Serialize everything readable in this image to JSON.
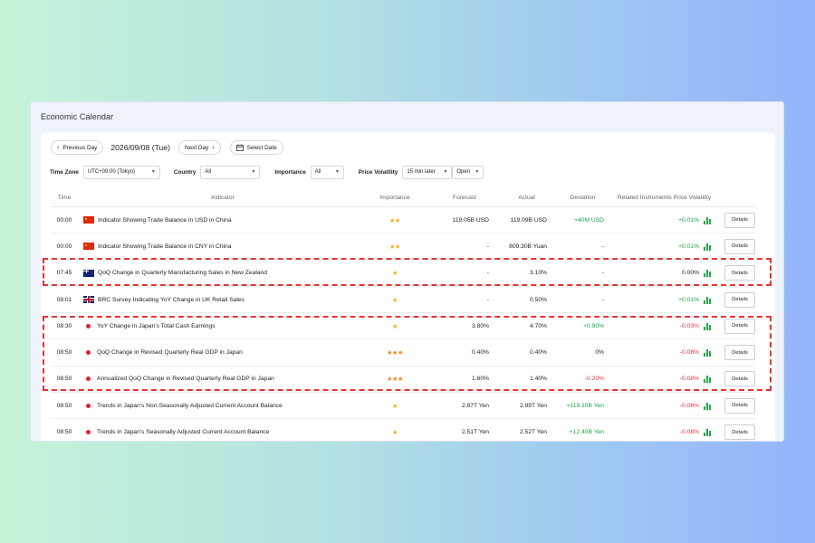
{
  "panel": {
    "title": "Economic Calendar"
  },
  "toolbar": {
    "prev_label": "Previous Day",
    "date": "2026/09/08 (Tue)",
    "next_label": "Next Day",
    "select_date_label": "Select Date"
  },
  "filters": {
    "timezone_label": "Time Zone",
    "timezone_value": "UTC+09:00 (Tokyo)",
    "country_label": "Country",
    "country_value": "All",
    "importance_label": "Importance",
    "importance_value": "All",
    "volatility_label": "Price Volatility",
    "volatility_value": "15 min later",
    "volatility_mode": "Open"
  },
  "table": {
    "headers": {
      "time": "Time",
      "indicator": "Indicator",
      "importance": "Importance",
      "forecast": "Forecast",
      "actual": "Actual",
      "deviation": "Deviation",
      "volatility": "Related Instruments Price Volatility"
    },
    "details_label": "Details",
    "rows": [
      {
        "time": "00:00",
        "flag": "cn",
        "indicator": "Indicator Showing Trade Balance in USD in China",
        "importance": "★★",
        "forecast": "119.05B USD",
        "actual": "119.09B USD",
        "deviation": "+40M USD",
        "volatility": "+0.01%"
      },
      {
        "time": "00:00",
        "flag": "cn",
        "indicator": "Indicator Showing Trade Balance in CNY in China",
        "importance": "★★",
        "forecast": "-",
        "actual": "809.30B Yuan",
        "deviation": "-",
        "volatility": "+0.01%"
      },
      {
        "time": "07:45",
        "flag": "nz",
        "indicator": "QoQ Change in Quarterly Manufacturing Sales in New Zealand",
        "importance": "★",
        "forecast": "-",
        "actual": "3.10%",
        "deviation": "-",
        "volatility": "0.00%"
      },
      {
        "time": "08:01",
        "flag": "gb",
        "indicator": "BRC Survey Indicating YoY Change in UK Retail Sales",
        "importance": "★",
        "forecast": "-",
        "actual": "0.50%",
        "deviation": "-",
        "volatility": "+0.01%"
      },
      {
        "time": "08:30",
        "flag": "jp",
        "indicator": "YoY Change in Japan's Total Cash Earnings",
        "importance": "★",
        "forecast": "3.80%",
        "actual": "4.70%",
        "deviation": "+0.90%",
        "volatility": "-0.03%"
      },
      {
        "time": "08:50",
        "flag": "jp",
        "indicator": "QoQ Change in Revised Quarterly Real GDP in Japan",
        "importance": "★★★",
        "forecast": "0.40%",
        "actual": "0.40%",
        "deviation": "0%",
        "volatility": "-0.08%"
      },
      {
        "time": "08:50",
        "flag": "jp",
        "indicator": "Annualized QoQ Change in Revised Quarterly Real GDP in Japan",
        "importance": "★★★",
        "forecast": "1.60%",
        "actual": "1.40%",
        "deviation": "-0.20%",
        "volatility": "-0.08%"
      },
      {
        "time": "08:50",
        "flag": "jp",
        "indicator": "Trends in Japan's Non-Seasonally Adjusted Current Account Balance",
        "importance": "★",
        "forecast": "2.87T Yen",
        "actual": "2.99T Yen",
        "deviation": "+119.10B Yen",
        "volatility": "-0.08%"
      },
      {
        "time": "08:50",
        "flag": "jp",
        "indicator": "Trends in Japan's Seasonally Adjusted Current Account Balance",
        "importance": "★",
        "forecast": "2.51T Yen",
        "actual": "2.52T Yen",
        "deviation": "+12.40B Yen",
        "volatility": "-0.08%"
      }
    ]
  },
  "colors": {
    "positive": "#17a34a",
    "negative": "#e5323b",
    "highlight": "#e53438",
    "star": "#f4b01a"
  }
}
